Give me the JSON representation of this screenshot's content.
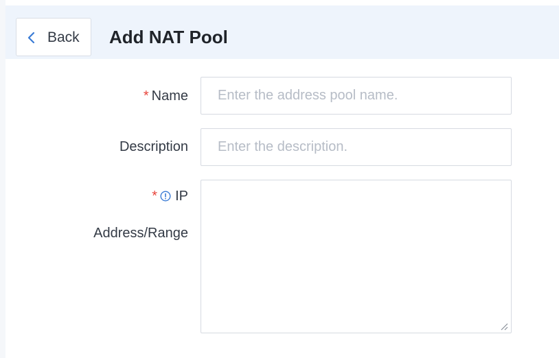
{
  "header": {
    "back_label": "Back",
    "back_icon": "chevron-left-icon",
    "title": "Add NAT Pool"
  },
  "form": {
    "name": {
      "required_mark": "*",
      "label": "Name",
      "value": "",
      "placeholder": "Enter the address pool name."
    },
    "description": {
      "label": "Description",
      "value": "",
      "placeholder": "Enter the description."
    },
    "ip_range": {
      "required_mark": "*",
      "info_icon": "info-circle-icon",
      "label_line1": "IP",
      "label_line2": "Address/Range",
      "value": ""
    }
  },
  "colors": {
    "header_background": "#eef4fc",
    "required": "#e8453c",
    "info_icon": "#3a7bd5",
    "placeholder": "#b6bcc6"
  }
}
